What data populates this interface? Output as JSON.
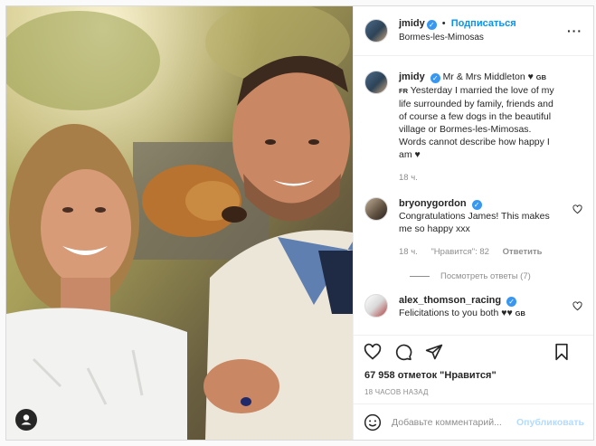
{
  "header": {
    "username": "jmidy",
    "verified_mark": "✓",
    "separator": "•",
    "follow_label": "Подписаться",
    "location": "Bormes-les-Mimosas",
    "more_label": "···"
  },
  "caption": {
    "username": "jmidy",
    "text_line1": "Mr & Mrs Middleton ♥",
    "flags": "GB FR",
    "text_rest": "Yesterday I married the love of my life surrounded by family, friends and of course a few dogs in the beautiful village or Bormes-les-Mimosas. Words cannot describe how happy I am ♥",
    "time": "18 ч."
  },
  "comments": [
    {
      "username": "bryonygordon",
      "text": "Congratulations James! This makes me so happy xxx",
      "time": "18 ч.",
      "likes_label": "\"Нравится\": 82",
      "reply_label": "Ответить"
    },
    {
      "username": "alex_thomson_racing",
      "text": "Felicitations to you both ♥♥",
      "flag": "GB"
    }
  ],
  "view_replies_label": "Посмотреть ответы (7)",
  "likes_count": "67 958 отметок \"Нравится\"",
  "post_time": "18 часов назад",
  "comment_input": {
    "placeholder": "Добавьте комментарий...",
    "publish_label": "Опубликовать"
  },
  "icons": {
    "like": "heart-icon",
    "comment": "comment-icon",
    "share": "share-icon",
    "save": "bookmark-icon",
    "emoji": "emoji-icon",
    "tag": "user-tag-icon"
  },
  "colors": {
    "accent": "#0095f6",
    "verified": "#3897f0",
    "publish_disabled": "#b3dbff",
    "muted": "#8e8e8e"
  }
}
